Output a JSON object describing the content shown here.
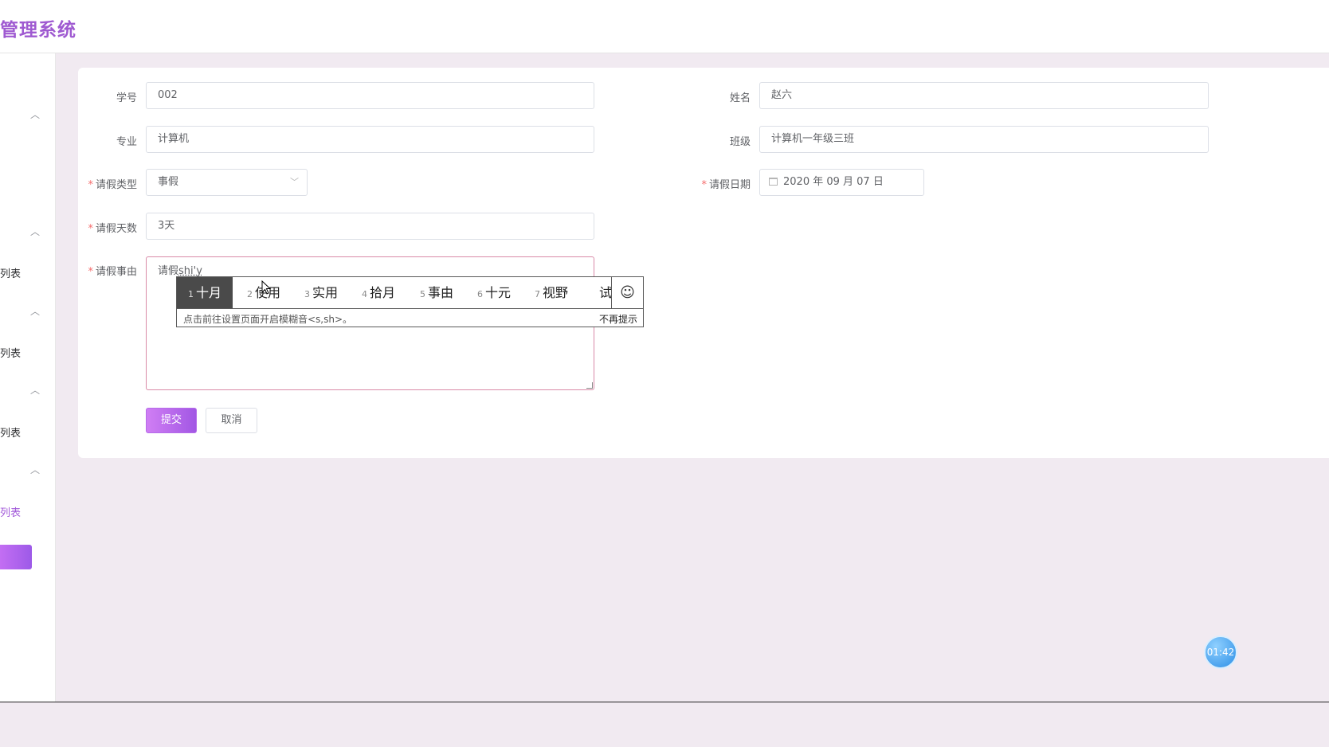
{
  "header": {
    "title": "管理系统"
  },
  "sidebar": {
    "items": [
      {
        "label": "列表"
      },
      {
        "label": "列表"
      },
      {
        "label": "列表"
      },
      {
        "label": "列表",
        "active": true
      }
    ]
  },
  "form": {
    "student_id": {
      "label": "学号",
      "value": "002"
    },
    "name": {
      "label": "姓名",
      "value": "赵六"
    },
    "major": {
      "label": "专业",
      "value": "计算机"
    },
    "class": {
      "label": "班级",
      "value": "计算机一年级三班"
    },
    "leave_type": {
      "label": "请假类型",
      "value": "事假"
    },
    "leave_date": {
      "label": "请假日期",
      "value": "2020 年 09 月 07 日"
    },
    "leave_days": {
      "label": "请假天数",
      "value": "3天"
    },
    "reason": {
      "label": "请假事由",
      "value": "请假",
      "composing": "shi'y"
    },
    "required_mark": "*"
  },
  "buttons": {
    "submit": "提交",
    "cancel": "取消"
  },
  "ime": {
    "candidates": [
      {
        "num": "1",
        "text": "十月"
      },
      {
        "num": "2",
        "text": "使用"
      },
      {
        "num": "3",
        "text": "实用"
      },
      {
        "num": "4",
        "text": "拾月"
      },
      {
        "num": "5",
        "text": "事由"
      },
      {
        "num": "6",
        "text": "十元"
      },
      {
        "num": "7",
        "text": "视野"
      },
      {
        "num": "",
        "text": "试"
      }
    ],
    "emoji": "☺",
    "hint": "点击前往设置页面开启模糊音<s,sh>。",
    "dismiss": "不再提示"
  },
  "timer": "01:42",
  "colors": {
    "accent": "#9f5ad1",
    "required": "#f56c6c"
  }
}
